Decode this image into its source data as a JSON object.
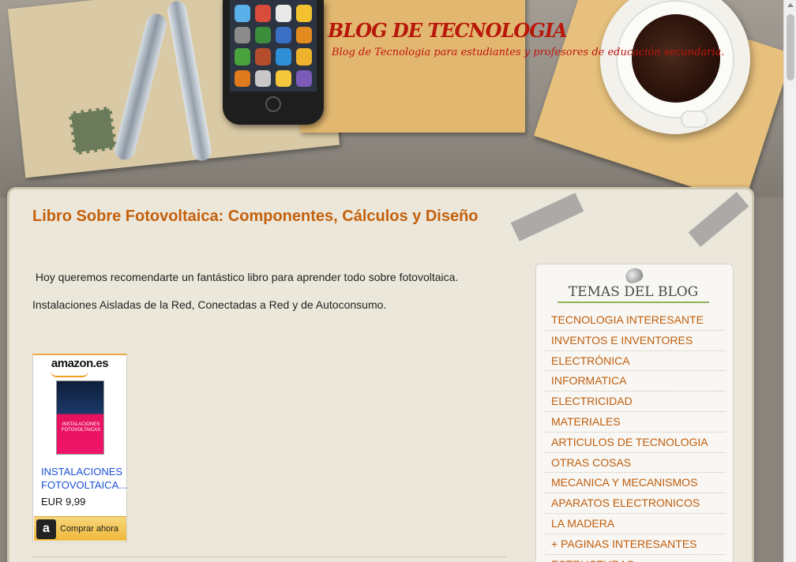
{
  "header": {
    "blog_title": "BLOG DE TECNOLOGIA",
    "blog_description": "Blog de Tecnologia para estudiantes y profesores de educación secundaria."
  },
  "post": {
    "title": "Libro Sobre Fotovoltaica: Componentes, Cálculos y Diseño",
    "paragraph_1": " Hoy queremos recomendarte un fantástico libro para aprender todo sobre fotovoltaica.",
    "paragraph_2": "Instalaciones Aisladas de la Red, Conectadas a Red y de Autoconsumo."
  },
  "amazon_widget": {
    "store_logo": "amazon.es",
    "product_name": "INSTALACIONES FOTOVOLTAICA...",
    "price": "EUR 9,99",
    "buy_label": "Comprar ahora",
    "buy_icon": "amazon-a-icon"
  },
  "sidebar": {
    "widget_title": "TEMAS DEL BLOG",
    "topics": [
      "TECNOLOGIA INTERESANTE",
      "INVENTOS E INVENTORES",
      "ELECTRÓNICA",
      "INFORMATICA",
      "ELECTRICIDAD",
      "MATERIALES",
      "ARTICULOS DE TECNOLOGIA",
      "OTRAS COSAS",
      "MECANICA Y MECANISMOS",
      "APARATOS ELECTRONICOS",
      "LA MADERA",
      "+ PAGINAS INTERESANTES",
      "ESTRUCTURAS"
    ]
  },
  "colors": {
    "title_red": "#b8170a",
    "link_orange": "#c05d0d",
    "post_title_orange": "#c4600b",
    "amazon_link_blue": "#1a4fd4"
  }
}
